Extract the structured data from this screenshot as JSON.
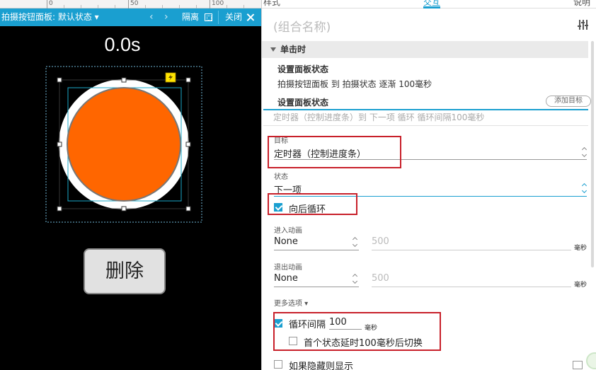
{
  "ruler": {
    "ticks": [
      "0",
      "50",
      "100"
    ]
  },
  "canvas": {
    "panel_title": "拍摄按钮面板: 默认状态 ▾",
    "nav_prev": "‹",
    "nav_next": "›",
    "isolate_label": "隔离",
    "close_label": "关闭",
    "timer_text": "0.0s",
    "delete_label": "删除",
    "colors": {
      "canvas_bg": "#000000",
      "button_fill": "#ff6600",
      "header_bar": "#1a9fd0"
    }
  },
  "panel": {
    "tabs": [
      {
        "label": "样式",
        "active": false
      },
      {
        "label": "交互",
        "active": true
      },
      {
        "label": "说明",
        "active": false
      }
    ],
    "group_name_placeholder": "(组合名称)",
    "event_header": "单击时",
    "actions": [
      {
        "title": "设置面板状态",
        "description": "拍摄按钮面板 到 拍摄状态 逐渐 100毫秒"
      },
      {
        "title": "设置面板状态",
        "description": "定时器（控制进度条）到 下一项 循环 循环间隔100毫秒",
        "selected": true
      }
    ],
    "add_target_label": "添加目标",
    "target": {
      "label": "目标",
      "value": "定时器（控制进度条）"
    },
    "state": {
      "label": "状态",
      "value": "下一项"
    },
    "wrap_option": {
      "label": "向后循环",
      "checked": true
    },
    "enter_animation": {
      "label": "进入动画",
      "value": "None",
      "duration": "500",
      "unit": "毫秒"
    },
    "exit_animation": {
      "label": "退出动画",
      "value": "None",
      "duration": "500",
      "unit": "毫秒"
    },
    "more_options_label": "更多选项 ▾",
    "loop_interval": {
      "label": "循环间隔",
      "value": "100",
      "unit": "毫秒",
      "checked": true
    },
    "first_delay": {
      "label": "首个状态延时100毫秒后切换",
      "checked": false
    },
    "show_if_hidden": {
      "label": "如果隐藏则显示",
      "checked": false
    }
  }
}
